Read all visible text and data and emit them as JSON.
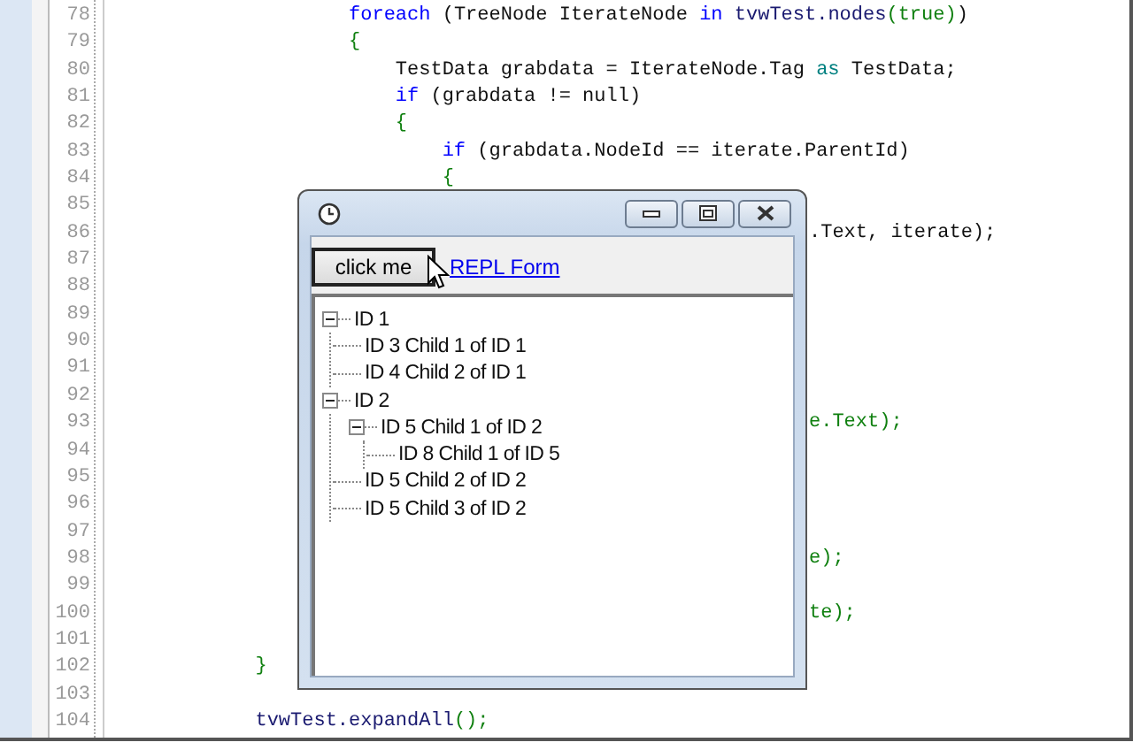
{
  "editor": {
    "lines": [
      {
        "number": "78",
        "covered": false,
        "tokens": [
          {
            "kind": "keyword",
            "text": "                    foreach "
          },
          {
            "kind": "plain",
            "text": "(TreeNode IterateNode "
          },
          {
            "kind": "keyword",
            "text": "in "
          },
          {
            "kind": "member",
            "text": "tvwTest.nodes"
          },
          {
            "kind": "literal",
            "text": "(true)"
          },
          {
            "kind": "plain",
            "text": ")"
          }
        ]
      },
      {
        "number": "79",
        "covered": false,
        "tokens": [
          {
            "kind": "literal",
            "text": "                    {"
          }
        ]
      },
      {
        "number": "80",
        "covered": false,
        "tokens": [
          {
            "kind": "plain",
            "text": "                        TestData grabdata = IterateNode.Tag "
          },
          {
            "kind": "operator",
            "text": "as "
          },
          {
            "kind": "plain",
            "text": "TestData;"
          }
        ]
      },
      {
        "number": "81",
        "covered": false,
        "tokens": [
          {
            "kind": "keyword",
            "text": "                        if "
          },
          {
            "kind": "plain",
            "text": "(grabdata != null)"
          }
        ]
      },
      {
        "number": "82",
        "covered": false,
        "tokens": [
          {
            "kind": "literal",
            "text": "                        {"
          }
        ]
      },
      {
        "number": "83",
        "covered": false,
        "tokens": [
          {
            "kind": "keyword",
            "text": "                            if "
          },
          {
            "kind": "plain",
            "text": "(grabdata.NodeId == iterate.ParentId)"
          }
        ]
      },
      {
        "number": "84",
        "covered": false,
        "tokens": [
          {
            "kind": "literal",
            "text": "                            {"
          }
        ]
      },
      {
        "number": "85",
        "covered": true
      },
      {
        "number": "86",
        "covered": true,
        "tokens": [
          {
            "kind": "plain",
            "text": ".Text, iterate);"
          }
        ]
      },
      {
        "number": "87",
        "covered": true
      },
      {
        "number": "88",
        "covered": true
      },
      {
        "number": "89",
        "covered": true
      },
      {
        "number": "90",
        "covered": true
      },
      {
        "number": "91",
        "covered": true
      },
      {
        "number": "92",
        "covered": true
      },
      {
        "number": "93",
        "covered": true,
        "tokens": [
          {
            "kind": "literal",
            "text": "e.Text);"
          }
        ]
      },
      {
        "number": "94",
        "covered": true
      },
      {
        "number": "95",
        "covered": true
      },
      {
        "number": "96",
        "covered": true
      },
      {
        "number": "97",
        "covered": true
      },
      {
        "number": "98",
        "covered": true,
        "tokens": [
          {
            "kind": "literal",
            "text": "e);"
          }
        ]
      },
      {
        "number": "99",
        "covered": true
      },
      {
        "number": "100",
        "covered": true,
        "tokens": [
          {
            "kind": "literal",
            "text": "te);"
          }
        ]
      },
      {
        "number": "101",
        "covered": true
      },
      {
        "number": "102",
        "covered": false,
        "tokens": [
          {
            "kind": "literal",
            "text": "            }"
          }
        ]
      },
      {
        "number": "103",
        "covered": false
      },
      {
        "number": "104",
        "covered": false,
        "tokens": [
          {
            "kind": "member",
            "text": "            tvwTest.expandAll"
          },
          {
            "kind": "literal",
            "text": "();"
          }
        ]
      }
    ]
  },
  "form": {
    "button": "click me",
    "link": "REPL Form",
    "tree": [
      {
        "label": "ID 1",
        "expanded": true,
        "children": [
          {
            "label": "ID 3 Child 1 of ID 1"
          },
          {
            "label": "ID 4 Child 2 of ID 1"
          }
        ]
      },
      {
        "label": "ID 2",
        "expanded": true,
        "children": [
          {
            "label": "ID 5 Child 1 of ID 2",
            "expanded": true,
            "children": [
              {
                "label": "ID 8 Child 1 of ID 5"
              }
            ]
          },
          {
            "label": "ID 5 Child 2 of ID 2"
          },
          {
            "label": "ID 5 Child 3 of ID 2"
          }
        ]
      }
    ]
  }
}
